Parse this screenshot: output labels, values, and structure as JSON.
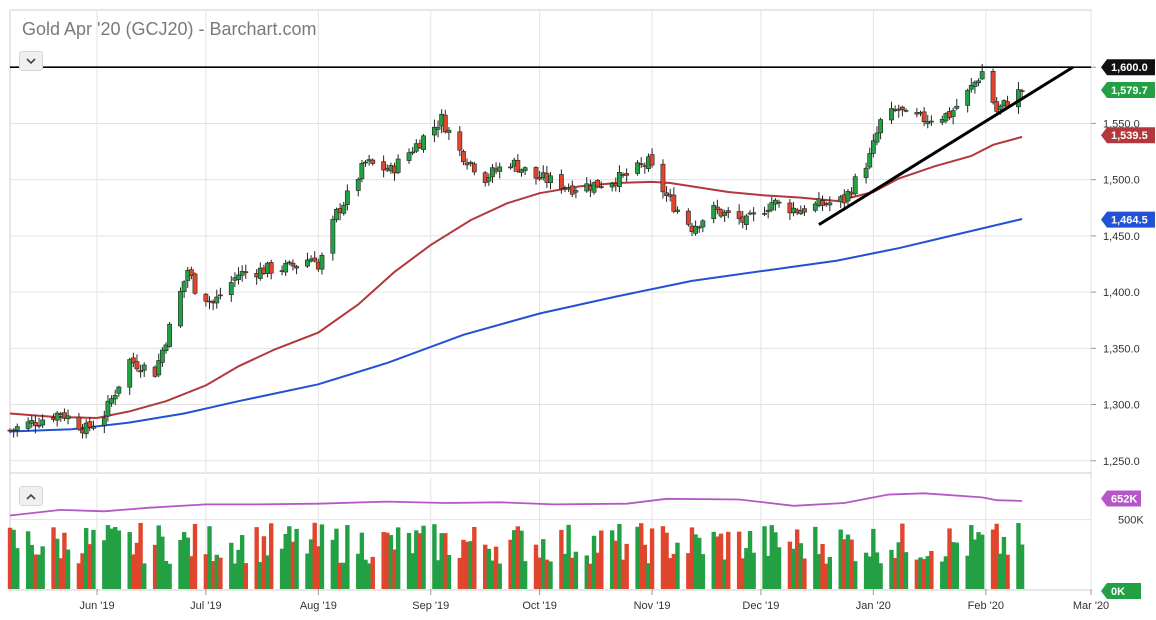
{
  "title": "Gold Apr '20 (GCJ20) - Barchart.com",
  "controls": {
    "price_toggle_icon": "chevron-down-icon",
    "volume_toggle_icon": "chevron-up-icon"
  },
  "colors": {
    "up": "#23a043",
    "down": "#e0462d",
    "ma50": "#b2383c",
    "ma200": "#2152d6",
    "volume_avg": "#b657c8",
    "grid": "#e3e3e3",
    "trendline": "#000000",
    "blue_volume": "#2152d6"
  },
  "chart_data": [
    {
      "type": "candlestick",
      "title": "Gold Apr '20 (GCJ20) - Barchart.com",
      "y_ticks": [
        "1,250.0",
        "1,300.0",
        "1,350.0",
        "1,400.0",
        "1,450.0",
        "1,500.0",
        "1,550.0",
        "1,600.0"
      ],
      "ylim": [
        1240,
        1650
      ],
      "x_ticks": [
        "Jun '19",
        "Jul '19",
        "Aug '19",
        "Sep '19",
        "Oct '19",
        "Nov '19",
        "Dec '19",
        "Jan '20",
        "Feb '20",
        "Mar '20"
      ],
      "x_range": [
        "2019-05-08",
        "2020-03-01"
      ],
      "grid": true,
      "price_labels": [
        {
          "label": "1,600.0",
          "value": 1600,
          "style": "dark"
        },
        {
          "label": "1,579.7",
          "value": 1579.7,
          "style": "green"
        },
        {
          "label": "1,539.5",
          "value": 1539.5,
          "style": "red"
        },
        {
          "label": "1,464.5",
          "value": 1464.5,
          "style": "blue"
        }
      ],
      "horizontal_line": {
        "value": 1600
      },
      "trendline": {
        "start": [
          "2019-12-17",
          1460
        ],
        "end": [
          "2020-02-25",
          1600
        ]
      },
      "series": [
        {
          "kind": "moving_average",
          "points": [
            [
              "2019-05-08",
              1292
            ],
            [
              "2019-05-20",
              1289
            ],
            [
              "2019-06-01",
              1288
            ],
            [
              "2019-06-10",
              1294
            ],
            [
              "2019-06-20",
              1303
            ],
            [
              "2019-07-01",
              1317
            ],
            [
              "2019-07-10",
              1334
            ],
            [
              "2019-07-20",
              1349
            ],
            [
              "2019-08-01",
              1364
            ],
            [
              "2019-08-12",
              1389
            ],
            [
              "2019-08-22",
              1418
            ],
            [
              "2019-09-01",
              1442
            ],
            [
              "2019-09-12",
              1464
            ],
            [
              "2019-09-22",
              1479
            ],
            [
              "2019-10-01",
              1488
            ],
            [
              "2019-10-12",
              1494
            ],
            [
              "2019-10-22",
              1497
            ],
            [
              "2019-11-01",
              1498
            ],
            [
              "2019-11-06",
              1497
            ],
            [
              "2019-11-12",
              1494
            ],
            [
              "2019-11-22",
              1489
            ],
            [
              "2019-12-02",
              1486
            ],
            [
              "2019-12-12",
              1484
            ],
            [
              "2019-12-22",
              1481
            ],
            [
              "2020-01-01",
              1489
            ],
            [
              "2020-01-08",
              1501
            ],
            [
              "2020-01-18",
              1512
            ],
            [
              "2020-01-28",
              1521
            ],
            [
              "2020-02-03",
              1531
            ],
            [
              "2020-02-11",
              1538
            ]
          ]
        },
        {
          "kind": "moving_average",
          "points": [
            [
              "2019-05-08",
              1276
            ],
            [
              "2019-05-25",
              1278
            ],
            [
              "2019-06-10",
              1284
            ],
            [
              "2019-06-25",
              1292
            ],
            [
              "2019-07-10",
              1303
            ],
            [
              "2019-08-01",
              1318
            ],
            [
              "2019-08-20",
              1337
            ],
            [
              "2019-09-10",
              1362
            ],
            [
              "2019-10-01",
              1381
            ],
            [
              "2019-10-22",
              1396
            ],
            [
              "2019-11-12",
              1410
            ],
            [
              "2019-12-02",
              1419
            ],
            [
              "2019-12-22",
              1428
            ],
            [
              "2020-01-08",
              1439
            ],
            [
              "2020-01-21",
              1449
            ],
            [
              "2020-02-11",
              1465
            ]
          ]
        },
        {
          "kind": "candles",
          "anchors": [
            [
              "2019-05-08",
              1277
            ],
            [
              "2019-05-15",
              1285
            ],
            [
              "2019-05-22",
              1293
            ],
            [
              "2019-05-29",
              1278
            ],
            [
              "2019-06-03",
              1291
            ],
            [
              "2019-06-10",
              1339
            ],
            [
              "2019-06-17",
              1329
            ],
            [
              "2019-06-21",
              1368
            ],
            [
              "2019-06-26",
              1420
            ],
            [
              "2019-06-28",
              1404
            ],
            [
              "2019-07-03",
              1390
            ],
            [
              "2019-07-10",
              1416
            ],
            [
              "2019-07-17",
              1420
            ],
            [
              "2019-07-24",
              1422
            ],
            [
              "2019-07-31",
              1432
            ],
            [
              "2019-08-01",
              1420
            ],
            [
              "2019-08-06",
              1470
            ],
            [
              "2019-08-09",
              1485
            ],
            [
              "2019-08-14",
              1515
            ],
            [
              "2019-08-21",
              1508
            ],
            [
              "2019-08-28",
              1531
            ],
            [
              "2019-09-04",
              1554
            ],
            [
              "2019-09-09",
              1525
            ],
            [
              "2019-09-16",
              1502
            ],
            [
              "2019-09-23",
              1516
            ],
            [
              "2019-09-30",
              1502
            ],
            [
              "2019-10-03",
              1500
            ],
            [
              "2019-10-10",
              1493
            ],
            [
              "2019-10-17",
              1496
            ],
            [
              "2019-10-24",
              1502
            ],
            [
              "2019-10-31",
              1515
            ],
            [
              "2019-11-05",
              1485
            ],
            [
              "2019-11-12",
              1458
            ],
            [
              "2019-11-18",
              1473
            ],
            [
              "2019-11-27",
              1462
            ],
            [
              "2019-12-04",
              1480
            ],
            [
              "2019-12-11",
              1473
            ],
            [
              "2019-12-18",
              1478
            ],
            [
              "2019-12-24",
              1482
            ],
            [
              "2019-12-31",
              1520
            ],
            [
              "2020-01-03",
              1551
            ],
            [
              "2020-01-08",
              1563
            ],
            [
              "2020-01-10",
              1556
            ],
            [
              "2020-01-15",
              1554
            ],
            [
              "2020-01-22",
              1558
            ],
            [
              "2020-01-27",
              1577
            ],
            [
              "2020-01-31",
              1596
            ],
            [
              "2020-02-04",
              1561
            ],
            [
              "2020-02-11",
              1580
            ]
          ]
        },
        {
          "kind": "volume_average",
          "points": [
            [
              "2019-05-08",
              530
            ],
            [
              "2019-05-22",
              570
            ],
            [
              "2019-06-03",
              560
            ],
            [
              "2019-06-15",
              585
            ],
            [
              "2019-07-01",
              610
            ],
            [
              "2019-07-15",
              610
            ],
            [
              "2019-08-01",
              615
            ],
            [
              "2019-08-20",
              630
            ],
            [
              "2019-09-05",
              620
            ],
            [
              "2019-09-20",
              625
            ],
            [
              "2019-10-05",
              610
            ],
            [
              "2019-10-25",
              615
            ],
            [
              "2019-11-05",
              650
            ],
            [
              "2019-11-25",
              645
            ],
            [
              "2019-12-10",
              600
            ],
            [
              "2019-12-24",
              620
            ],
            [
              "2020-01-05",
              680
            ],
            [
              "2020-01-15",
              690
            ],
            [
              "2020-01-31",
              660
            ],
            [
              "2020-02-04",
              640
            ],
            [
              "2020-02-11",
              635
            ]
          ]
        }
      ],
      "volume": {
        "y_ticks": [
          "500K"
        ],
        "ylim": [
          0,
          800
        ],
        "badges": [
          {
            "label": "652K",
            "value": 652,
            "style": "purple"
          },
          {
            "label": "0K",
            "value": 0,
            "style": "green"
          }
        ]
      }
    }
  ]
}
